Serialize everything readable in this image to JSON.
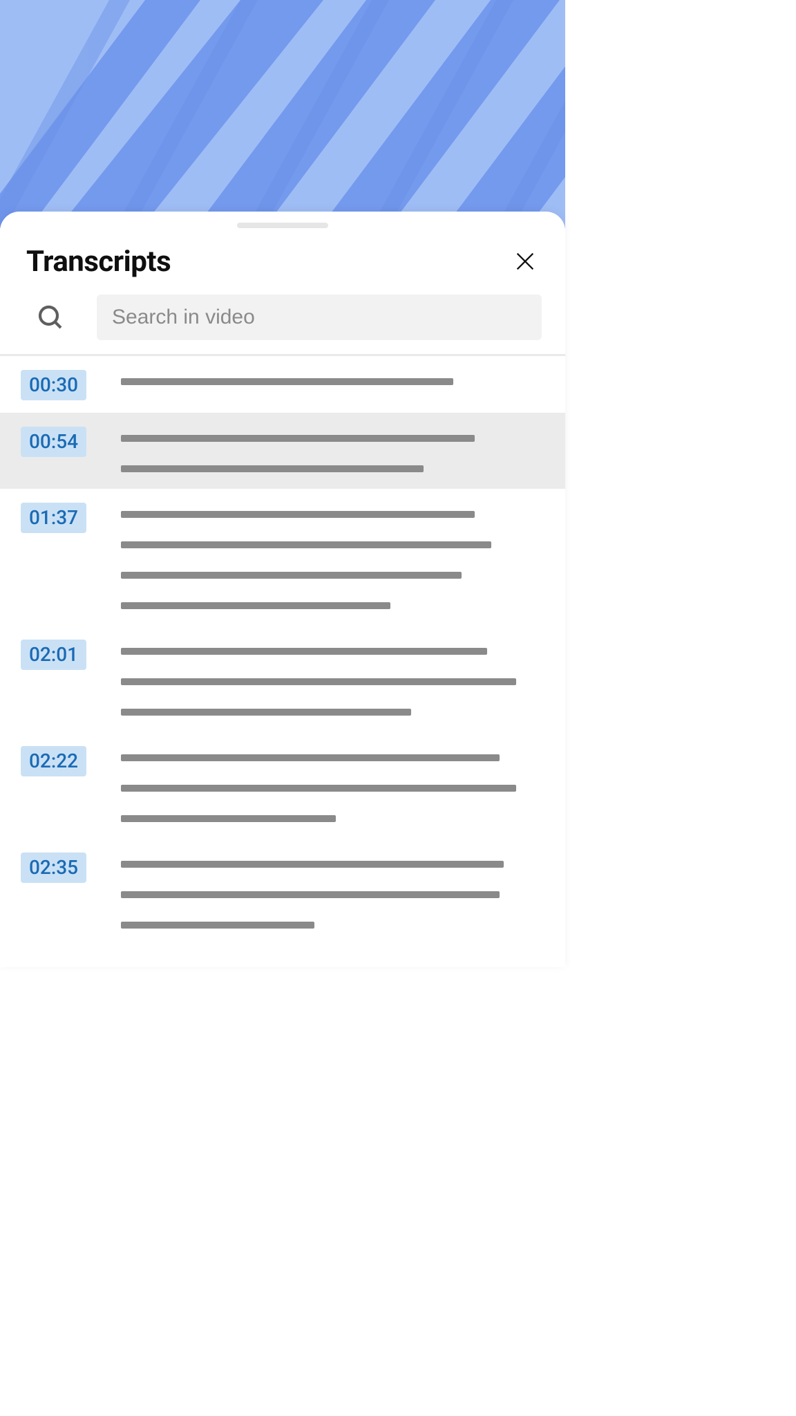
{
  "sheet": {
    "title": "Transcripts"
  },
  "search": {
    "placeholder": "Search in video",
    "value": ""
  },
  "timestamp_color": "#1a6ab5",
  "timestamp_bg": "#cae1f5",
  "active_index": 1,
  "transcript": [
    {
      "time": "00:30",
      "line_widths": [
        79
      ]
    },
    {
      "time": "00:54",
      "line_widths": [
        84,
        72
      ]
    },
    {
      "time": "01:37",
      "line_widths": [
        84,
        88,
        81,
        64
      ]
    },
    {
      "time": "02:01",
      "line_widths": [
        87,
        94,
        69
      ]
    },
    {
      "time": "02:22",
      "line_widths": [
        90,
        94,
        51
      ]
    },
    {
      "time": "02:35",
      "line_widths": [
        91,
        90,
        46
      ]
    }
  ]
}
